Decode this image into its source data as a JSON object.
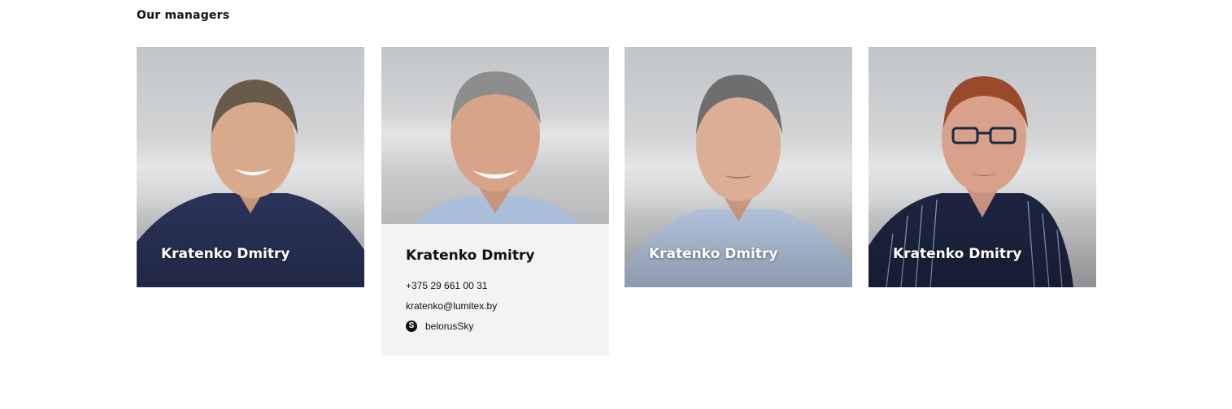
{
  "section": {
    "title": "Our managers"
  },
  "managers": [
    {
      "name": "Kratenko Dmitry",
      "shirt": "#2a3358",
      "hair": "#6a5a4a",
      "skin": "#d9a98c"
    },
    {
      "name": "Kratenko Dmitry",
      "phone": "+375 29 661 00 31",
      "email": "kratenko@lumitex.by",
      "skype": "belorusSky",
      "shirt": "#a9bfdc",
      "hair": "#8d8d8d",
      "skin": "#d7a48a"
    },
    {
      "name": "Kratenko Dmitry",
      "shirt": "#b4c6df",
      "hair": "#6e6e6e",
      "skin": "#dcae95"
    },
    {
      "name": "Kratenko Dmitry",
      "shirt": "#1d2440",
      "hair": "#9a4a2a",
      "skin": "#d9a08a"
    }
  ],
  "icons": {
    "skype": "skype-icon"
  }
}
